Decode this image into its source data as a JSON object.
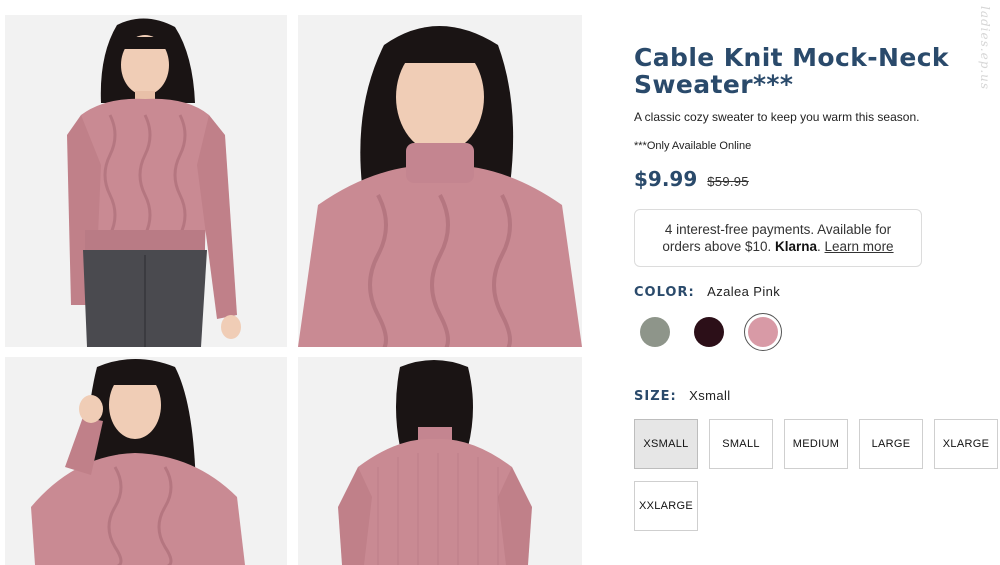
{
  "product": {
    "title": "Cable Knit Mock-Neck Sweater***",
    "description": "A classic cozy sweater to keep you warm this season.",
    "availability_note": "***Only Available Online",
    "price": "$9.99",
    "original_price": "$59.95"
  },
  "klarna": {
    "text_before": "4 interest-free payments. Available for orders above $10.",
    "brand": "Klarna",
    "dot": ".",
    "link": "Learn more"
  },
  "color": {
    "label": "COLOR:",
    "selected": "Azalea Pink",
    "swatches": [
      {
        "name": "Sage",
        "color": "#8e958a"
      },
      {
        "name": "Burgundy",
        "color": "#2c0f18"
      },
      {
        "name": "Azalea Pink",
        "color": "#d89aa6"
      }
    ]
  },
  "size": {
    "label": "SIZE:",
    "selected": "Xsmall",
    "options": [
      "XSMALL",
      "SMALL",
      "MEDIUM",
      "LARGE",
      "XLARGE",
      "XXLARGE"
    ]
  },
  "gallery": {
    "images": [
      "front-cropped-view",
      "close-up-front",
      "side-pose",
      "back-view"
    ]
  },
  "watermark": "ladies.ep.us",
  "colors": {
    "accent": "#2a4a6b",
    "sweater": "#c98a93",
    "hair": "#1a1414",
    "skin": "#f0cdb6",
    "jeans": "#4a4a4f"
  }
}
